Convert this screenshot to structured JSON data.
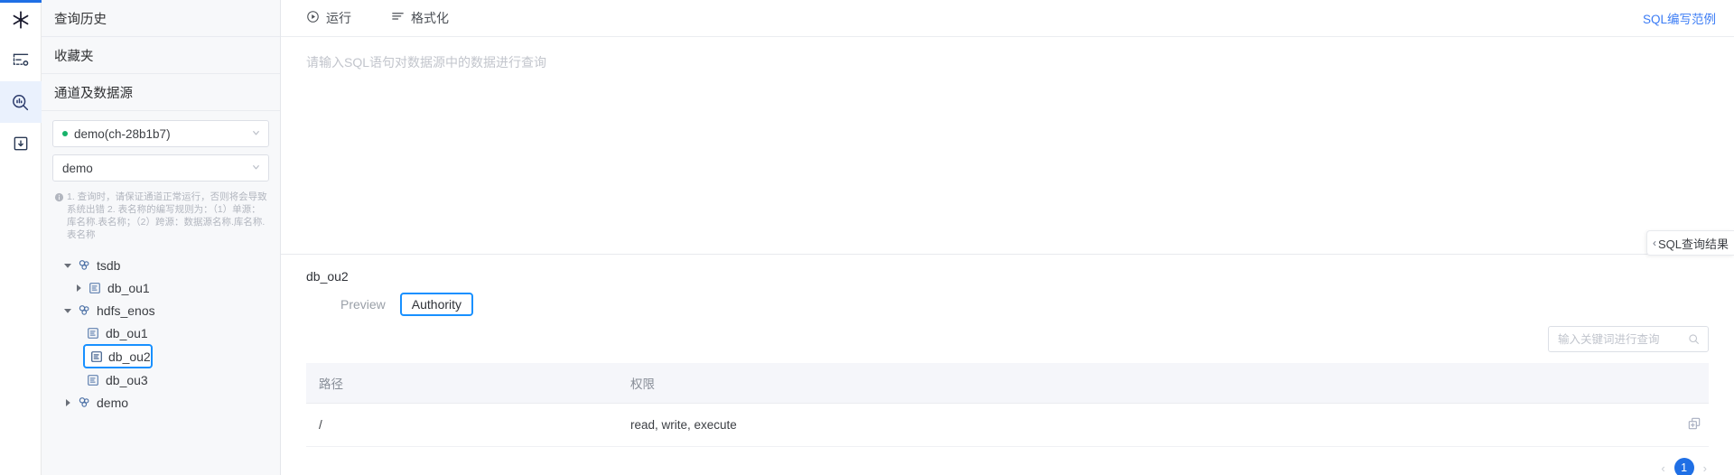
{
  "rail": {
    "items": [
      {
        "icon": "snowflake-logo-icon",
        "active": false
      },
      {
        "icon": "dashboard-icon",
        "active": false
      },
      {
        "icon": "query-search-icon",
        "active": true
      },
      {
        "icon": "save-disk-icon",
        "active": false
      }
    ]
  },
  "left_panel": {
    "query_history": "查询历史",
    "favorites": "收藏夹",
    "section_title": "通道及数据源",
    "channel_select": {
      "value": "demo(ch-28b1b7)",
      "status_color": "#17b26a"
    },
    "database_select": {
      "value": "demo"
    },
    "hint": "1. 查询时，请保证通道正常运行，否则将会导致系统出错 2. 表名称的编写规则为：（1）单源：库名称.表名称；（2）跨源：数据源名称.库名称.表名称",
    "tree": [
      {
        "label": "tsdb",
        "icon": "datasource-icon",
        "level": 0,
        "expanded": true,
        "arrow": "down",
        "selected": false
      },
      {
        "label": "db_ou1",
        "icon": "database-icon",
        "level": 1,
        "expanded": false,
        "arrow": "right",
        "selected": false
      },
      {
        "label": "hdfs_enos",
        "icon": "datasource-icon",
        "level": 0,
        "expanded": true,
        "arrow": "down",
        "selected": false
      },
      {
        "label": "db_ou1",
        "icon": "database-icon",
        "level": 1,
        "arrow": "none",
        "selected": false
      },
      {
        "label": "db_ou2",
        "icon": "database-icon",
        "level": 1,
        "arrow": "none",
        "selected": true
      },
      {
        "label": "db_ou3",
        "icon": "database-icon",
        "level": 1,
        "arrow": "none",
        "selected": false
      },
      {
        "label": "demo",
        "icon": "datasource-icon",
        "level": 0,
        "expanded": false,
        "arrow": "right",
        "selected": false
      }
    ]
  },
  "toolbar": {
    "run_label": "运行",
    "format_label": "格式化",
    "sql_example_link": "SQL编写范例"
  },
  "editor": {
    "placeholder": "请输入SQL语句对数据源中的数据进行查询",
    "value": ""
  },
  "results": {
    "title": "db_ou2",
    "tabs": [
      {
        "label": "Preview",
        "active": false
      },
      {
        "label": "Authority",
        "active": true
      }
    ],
    "search": {
      "placeholder": "输入关键词进行查询",
      "value": ""
    },
    "table": {
      "columns": [
        "路径",
        "权限",
        ""
      ],
      "rows": [
        {
          "path": "/",
          "permission": "read, write, execute",
          "action_icon": "copy-icon"
        }
      ]
    },
    "pagination": {
      "prev": "‹",
      "current": "1",
      "next": "›"
    }
  },
  "drawer": {
    "label": "SQL查询结果",
    "chevron": "‹"
  }
}
